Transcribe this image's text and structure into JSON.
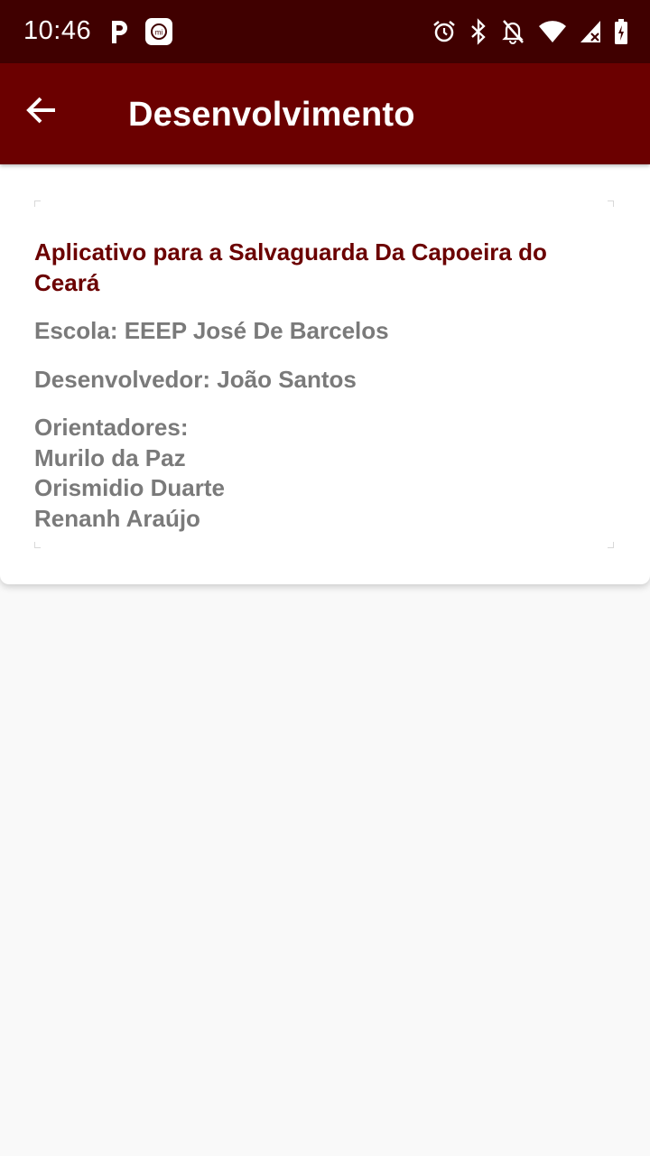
{
  "status_bar": {
    "time": "10:46",
    "left_icons": [
      "parking-p-icon",
      "mi-app-icon"
    ],
    "right_icons": [
      "alarm-clock-icon",
      "bluetooth-icon",
      "notifications-off-icon",
      "wifi-icon",
      "signal-icon",
      "battery-icon"
    ],
    "background": "#400000"
  },
  "app_bar": {
    "title": "Desenvolvimento",
    "back_icon": "arrow-back-icon",
    "background": "#6b0000"
  },
  "card": {
    "title": "Aplicativo para a Salvaguarda Da Capoeira do Ceará",
    "school": "Escola: EEEP José De Barcelos",
    "developer": "Desenvolvedor: João Santos",
    "advisors_label": "Orientadores:",
    "advisors": [
      "Murilo da Paz",
      "Orismidio Duarte",
      "Renanh Araújo"
    ],
    "title_color": "#6b0000",
    "text_color": "#7a7a7a"
  }
}
